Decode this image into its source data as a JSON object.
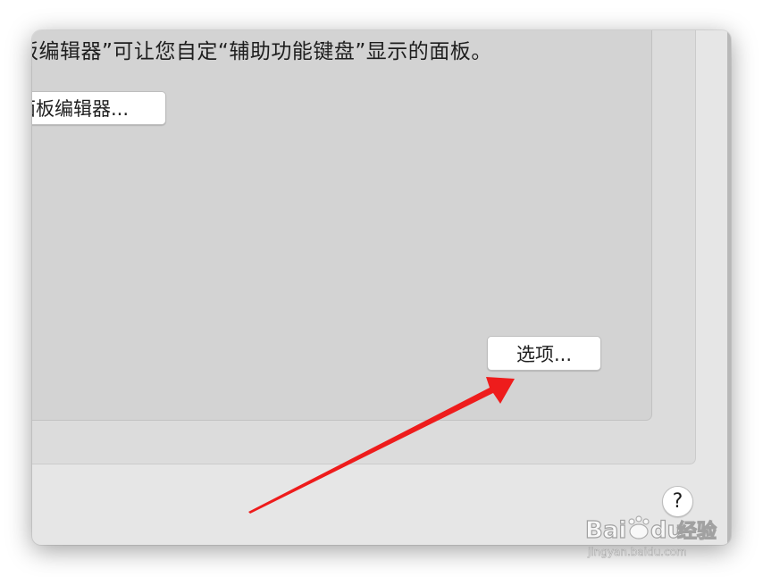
{
  "panel": {
    "description": "板编辑器”可让您自定“辅助功能键盘”显示的面板。",
    "panel_editor_button": "面板编辑器...",
    "options_button": "选项..."
  },
  "help_button": "?",
  "watermark": {
    "logo": "Bai du 经验",
    "url": "jingyan.baidu.com"
  },
  "colors": {
    "annotation_arrow": "#ee1c1c"
  },
  "icons": {
    "help": "question-mark-icon",
    "annotation": "red-arrow-icon"
  }
}
